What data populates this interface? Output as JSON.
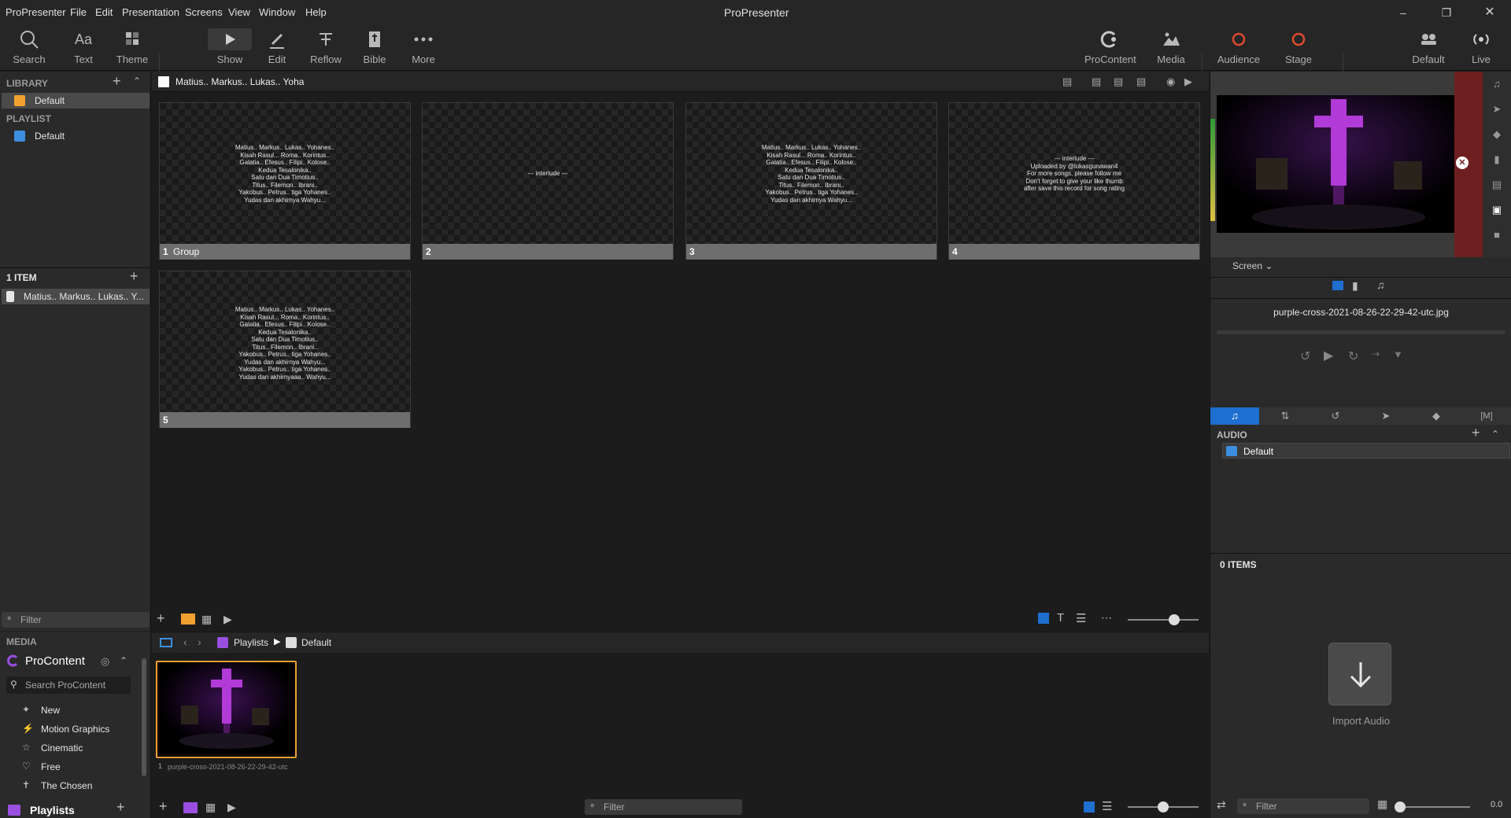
{
  "app": {
    "title": "ProPresenter"
  },
  "menu": [
    "ProPresenter",
    "File",
    "Edit",
    "Presentation",
    "Screens",
    "View",
    "Window",
    "Help"
  ],
  "toolbar": {
    "left": [
      {
        "label": "Search",
        "icon": "search-icon"
      },
      {
        "label": "Text",
        "icon": "text-icon"
      },
      {
        "label": "Theme",
        "icon": "theme-icon"
      },
      {
        "label": "Show",
        "icon": "play-icon"
      },
      {
        "label": "Edit",
        "icon": "pencil-icon"
      },
      {
        "label": "Reflow",
        "icon": "reflow-icon"
      },
      {
        "label": "Bible",
        "icon": "bible-icon"
      },
      {
        "label": "More",
        "icon": "more-icon"
      }
    ],
    "right": [
      {
        "label": "ProContent",
        "icon": "procontent-icon"
      },
      {
        "label": "Media",
        "icon": "media-icon"
      },
      {
        "label": "Audience",
        "icon": "audience-icon"
      },
      {
        "label": "Stage",
        "icon": "stage-icon"
      },
      {
        "label": "Default",
        "icon": "default-look-icon"
      },
      {
        "label": "Live",
        "icon": "live-icon"
      }
    ]
  },
  "library": {
    "header": "LIBRARY",
    "item": "Default",
    "playlist_header": "PLAYLIST",
    "playlist_item": "Default",
    "count_header": "1 ITEM",
    "selected_presentation": "Matius.. Markus.. Lukas.. Y...",
    "filter_placeholder": "Filter"
  },
  "presentation": {
    "title": "Matius.. Markus.. Lukas.. Yoha",
    "slides": [
      {
        "num": "1",
        "group": "Group",
        "text": "Matius.. Markus.. Lukas.. Yohanes..\nKisah Rasul... Roma.. Korintus..\nGalatia.. Efesus.. Filipi.. Kolose..\nKedua Tesalonika..\nSatu dan Dua Timotius..\nTitus.. Filemon.. Ibrani..\nYakobus.. Petrus.. tiga Yohanes..\nYudas dan akhirnya Wahyu..."
      },
      {
        "num": "2",
        "group": "",
        "text": "--- interlude ---"
      },
      {
        "num": "3",
        "group": "",
        "text": "Matius.. Markus.. Lukas.. Yohanes..\nKisah Rasul... Roma.. Korintus..\nGalatia.. Efesus.. Filipi.. Kolose..\nKedua Tesalonika..\nSatu dan Dua Timotius..\nTitus.. Filemon.. Ibrani..\nYakobus.. Petrus.. tiga Yohanes..\nYudas dan akhirnya Wahyu..."
      },
      {
        "num": "4",
        "group": "",
        "text": "--- interlude ---\nUploaded by @lukasgunawan4\nFor more songs, please follow me\nDon't forget to give your like thumb\nafter save this record for song rating"
      },
      {
        "num": "5",
        "group": "",
        "text": "Matius.. Markus.. Lukas.. Yohanes..\nKisah Rasul... Roma.. Korintus..\nGalatia.. Efesus.. Filipi.. Kolose..\nKedua Tesalonika..\nSatu dan Dua Timotius..\nTitus.. Filemon.. Ibrani..\nYakobus.. Petrus.. tiga Yohanes..\nYudas dan akhirnya Wahyu...\nYakobus.. Petrus.. tiga Yohanes..\nYudas dan akhirnyaaa.. Wahyu..."
      }
    ]
  },
  "media": {
    "header": "MEDIA",
    "procontent": "ProContent",
    "search_placeholder": "Search ProContent",
    "categories": [
      "New",
      "Motion Graphics",
      "Cinematic",
      "Free",
      "The Chosen"
    ],
    "playlists_label": "Playlists",
    "breadcrumb_root": "Playlists",
    "breadcrumb_item": "Default",
    "thumb_num": "1",
    "thumb_name": "purple-cross-2021-08-26-22-29-42-utc",
    "filter_placeholder": "Filter"
  },
  "preview": {
    "screen_label": "Screen",
    "filename": "purple-cross-2021-08-26-22-29-42-utc.jpg"
  },
  "audio": {
    "header": "AUDIO",
    "item": "Default",
    "count": "0 ITEMS",
    "import_label": "Import Audio",
    "filter_placeholder": "Filter",
    "volume": "0.0"
  },
  "colors": {
    "accent": "#f0a030",
    "blue": "#1e6fd0",
    "live_red": "#7a1f1f",
    "cross": "#b23ad6"
  }
}
